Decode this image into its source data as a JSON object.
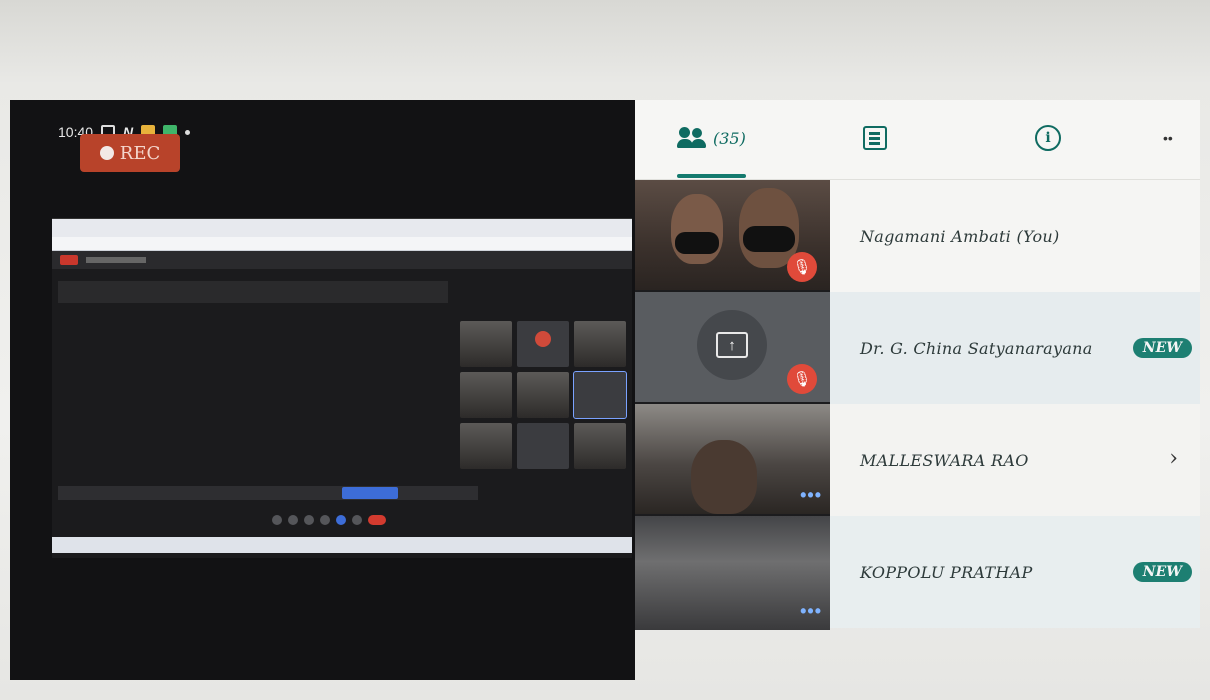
{
  "status_bar": {
    "time": "10:40",
    "n_glyph": "N",
    "rec_label": "REC"
  },
  "tabs": {
    "people": {
      "icon": "people-icon",
      "count": "(35)"
    },
    "chat": {
      "icon": "chat-icon"
    },
    "info": {
      "icon": "info-icon",
      "glyph": "i"
    },
    "more": {
      "icon": "more-icon",
      "glyph": "••"
    }
  },
  "participants": [
    {
      "name": "Nagamani Ambati (You)",
      "badge": "",
      "chevron": ""
    },
    {
      "name": "Dr. G. China Satyanarayana",
      "badge": "NEW",
      "chevron": ""
    },
    {
      "name": "MALLESWARA RAO",
      "badge": "",
      "chevron": "›"
    },
    {
      "name": "KOPPOLU PRATHAP",
      "badge": "NEW",
      "chevron": ""
    }
  ],
  "tiles": {
    "muted_glyph": "🎙",
    "share_glyph": "↑",
    "more_glyph": "•••"
  },
  "colors": {
    "accent": "#147a6e",
    "badge": "#1d7f72",
    "muted": "#e04a3a",
    "rec": "#b8432a"
  }
}
